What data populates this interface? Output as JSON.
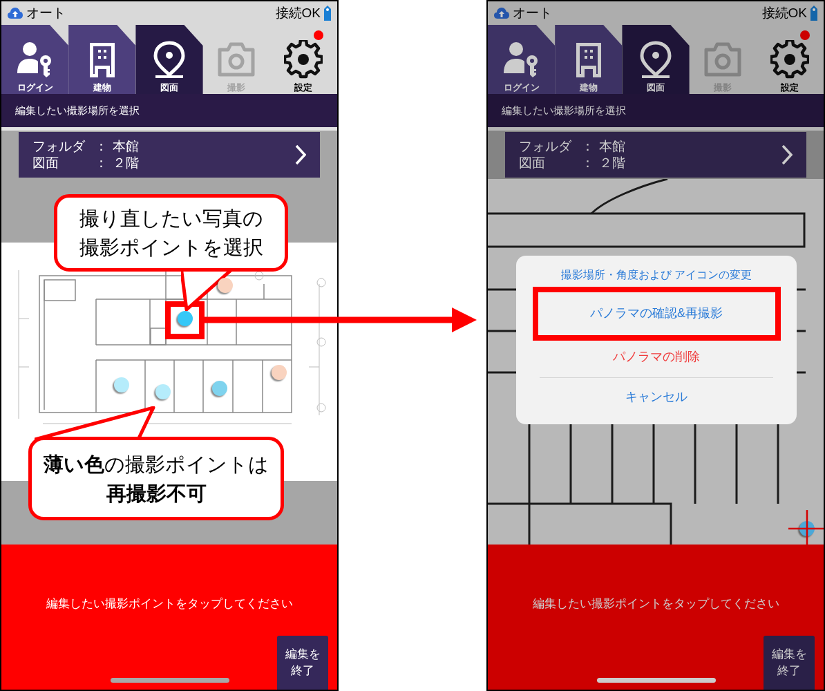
{
  "screens": [
    {
      "kind": "plan",
      "dimmed": false,
      "status_bar": {
        "mode": "オート",
        "connection": "接続OK"
      },
      "tabs": [
        {
          "label": "ログイン",
          "selected": false,
          "disabled": false,
          "badge": false
        },
        {
          "label": "建物",
          "selected": false,
          "disabled": false,
          "badge": false
        },
        {
          "label": "図面",
          "selected": true,
          "disabled": false,
          "badge": false
        },
        {
          "label": "撮影",
          "selected": false,
          "disabled": true,
          "badge": false
        },
        {
          "label": "設定",
          "selected": false,
          "disabled": false,
          "badge": true
        }
      ],
      "header": "編集したい撮影場所を選択",
      "location": [
        {
          "label": "フォルダ",
          "separator": "：",
          "value": "本館"
        },
        {
          "label": "図面",
          "separator": "：",
          "value": "２階"
        }
      ],
      "points": [
        {
          "color": "#35c8f7"
        },
        {
          "color": "#b5ecfb"
        },
        {
          "color": "#b5ecfb"
        },
        {
          "color": "#7fd3ee"
        },
        {
          "color": "#f9d3bf"
        },
        {
          "color": "#f9d3bf"
        }
      ],
      "message": "編集したい撮影ポイントをタップしてください",
      "finish_button": "編集を終了"
    },
    {
      "kind": "detail",
      "dimmed": true,
      "status_bar": {
        "mode": "オート",
        "connection": "接続OK"
      },
      "tabs": [
        {
          "label": "ログイン",
          "selected": false,
          "disabled": false,
          "badge": false
        },
        {
          "label": "建物",
          "selected": false,
          "disabled": false,
          "badge": false
        },
        {
          "label": "図面",
          "selected": true,
          "disabled": false,
          "badge": false
        },
        {
          "label": "撮影",
          "selected": false,
          "disabled": true,
          "badge": false
        },
        {
          "label": "設定",
          "selected": false,
          "disabled": false,
          "badge": true
        }
      ],
      "header": "編集したい撮影場所を選択",
      "location": [
        {
          "label": "フォルダ",
          "separator": "：",
          "value": "本館"
        },
        {
          "label": "図面",
          "separator": "：",
          "value": "２階"
        }
      ],
      "points": [
        {
          "color": "#4aa8d8"
        }
      ],
      "dialog": {
        "title": "撮影場所・角度および アイコンの変更",
        "actions": [
          {
            "label": "パノラマの確認&再撮影",
            "kind": "default"
          },
          {
            "label": "パノラマの削除",
            "kind": "destructive"
          },
          {
            "label": "キャンセル",
            "kind": "cancel"
          }
        ]
      },
      "message": "編集したい撮影ポイントをタップしてください",
      "finish_button": "編集を終了"
    }
  ],
  "annotations": [
    {
      "text": "撮り直したい写真の撮影ポイントを選択"
    },
    {
      "text": "**薄い色**の撮影ポイントは**再撮影不可**"
    }
  ]
}
